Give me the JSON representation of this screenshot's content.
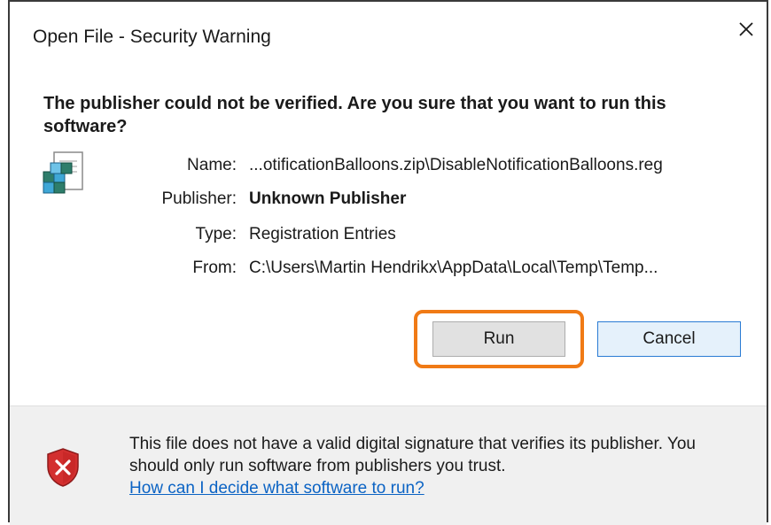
{
  "window": {
    "title": "Open File - Security Warning",
    "close_label": "✕"
  },
  "question": "The publisher could not be verified. Are you sure that you want to run this software?",
  "file": {
    "icon": "registry-file-icon",
    "details": [
      {
        "label": "Name:",
        "value": "...otificationBalloons.zip\\DisableNotificationBalloons.reg",
        "bold": false
      },
      {
        "label": "Publisher:",
        "value": "Unknown Publisher",
        "bold": true
      },
      {
        "label": "Type:",
        "value": "Registration Entries",
        "bold": false
      },
      {
        "label": "From:",
        "value": "C:\\Users\\Martin Hendrikx\\AppData\\Local\\Temp\\Temp...",
        "bold": false
      }
    ]
  },
  "buttons": {
    "run_label": "Run",
    "cancel_label": "Cancel"
  },
  "footer": {
    "icon": "warning-shield-icon",
    "message": "This file does not have a valid digital signature that verifies its publisher. You should only run software from publishers you trust.",
    "link_text": "How can I decide what software to run?"
  },
  "colors": {
    "highlight": "#f07a15",
    "link": "#0b63c4",
    "shield_red": "#d32f2f"
  }
}
